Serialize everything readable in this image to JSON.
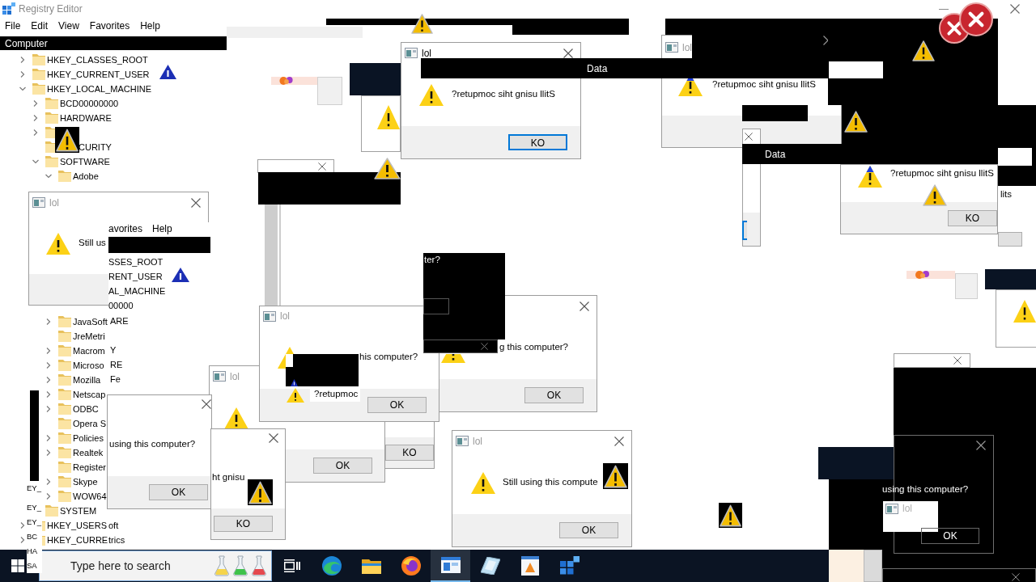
{
  "registry_editor": {
    "title": "Registry Editor",
    "menu": [
      "File",
      "Edit",
      "View",
      "Favorites",
      "Help"
    ],
    "address": "Computer",
    "tree": [
      {
        "label": "HKEY_CLASSES_ROOT",
        "kind": "node",
        "expanded": false
      },
      {
        "label": "HKEY_CURRENT_USER",
        "kind": "node",
        "expanded": false
      },
      {
        "label": "HKEY_LOCAL_MACHINE",
        "kind": "node",
        "expanded": true,
        "children": [
          {
            "label": "BCD00000000",
            "kind": "node",
            "expanded": false
          },
          {
            "label": "HARDWARE",
            "kind": "node",
            "expanded": false
          },
          {
            "kind": "node",
            "expanded": false
          },
          {
            "label": "CURITY",
            "kind": "leaf"
          },
          {
            "label": "SOFTWARE",
            "kind": "node",
            "expanded": true,
            "children": [
              {
                "label": "Adobe",
                "kind": "node",
                "expanded": true
              },
              {
                "label": "JavaSoft",
                "kind": "node",
                "expanded": false
              },
              {
                "label": "JreMetri",
                "kind": "leaf"
              },
              {
                "label": "Macrom",
                "kind": "node",
                "expanded": false
              },
              {
                "label": "Microso",
                "kind": "node",
                "expanded": false
              },
              {
                "label": "Mozilla",
                "kind": "node",
                "expanded": false
              },
              {
                "label": "Netscap",
                "kind": "node",
                "expanded": false
              },
              {
                "label": "ODBC",
                "kind": "node",
                "expanded": false
              },
              {
                "label": "Opera S",
                "kind": "leaf"
              },
              {
                "label": "Policies",
                "kind": "node",
                "expanded": false
              },
              {
                "label": "Realtek",
                "kind": "node",
                "expanded": false
              },
              {
                "label": "Register",
                "kind": "leaf"
              },
              {
                "label": "Skype",
                "kind": "node",
                "expanded": false
              },
              {
                "label": "WOW64",
                "kind": "node",
                "expanded": false
              }
            ]
          },
          {
            "label": "SYSTEM",
            "kind": "leaf"
          }
        ]
      },
      {
        "label": "HKEY_USERS",
        "kind": "node",
        "expanded": false
      },
      {
        "label": "HKEY_CURRE",
        "kind": "node",
        "expanded": false
      }
    ]
  },
  "column_headers": [
    "Data",
    "Data"
  ],
  "message_boxes": [
    {
      "title": "lol",
      "message": "?retupmoc siht gnisu llitS",
      "button": "KO",
      "active": true
    },
    {
      "title": "lol",
      "message": "?retupmoc siht gnisu llitS",
      "active": false
    },
    {
      "message": "?retupmoc siht gnisu llitS",
      "button": "KO",
      "active": false
    },
    {
      "title": "lol",
      "message": "Still us",
      "active": false
    },
    {
      "title": "lol",
      "message": "his computer?",
      "button": "OK",
      "active": false
    },
    {
      "message": "g this computer?",
      "button": "OK",
      "active": false
    },
    {
      "title": "lol",
      "button": "OK",
      "active": false
    },
    {
      "button": "KO",
      "active": false
    },
    {
      "message": "using this computer?",
      "button": "OK",
      "active": false
    },
    {
      "message": "ht gnisu",
      "button": "KO",
      "active": false
    },
    {
      "title": "lol",
      "message": "Still using this compute",
      "button": "OK",
      "active": false
    }
  ],
  "second_registry_fragment": {
    "menu": [
      "avorites",
      "Help"
    ],
    "keys": [
      "SSES_ROOT",
      "RENT_USER",
      "AL_MACHINE",
      "00000",
      "ARE",
      "Y",
      "RE",
      "Fe"
    ]
  },
  "stray_texts": [
    "ter?",
    "?retupmoc",
    "lits"
  ],
  "stray_key_fragments": [
    "oft",
    "trics"
  ],
  "left_key_fragments": [
    "EY_",
    "EY_",
    "EY_",
    "BC",
    "HA",
    "SA"
  ],
  "dark_dialog": {
    "message": "using this computer?",
    "title": "lol",
    "button": "OK"
  },
  "taskbar": {
    "search": {
      "placeholder": "Type here to search"
    },
    "apps": [
      {
        "selected": false
      },
      {
        "selected": false
      },
      {
        "selected": false
      },
      {
        "selected": false
      },
      {
        "selected": true
      },
      {
        "selected": false
      },
      {
        "selected": false
      },
      {
        "selected": false
      }
    ]
  }
}
